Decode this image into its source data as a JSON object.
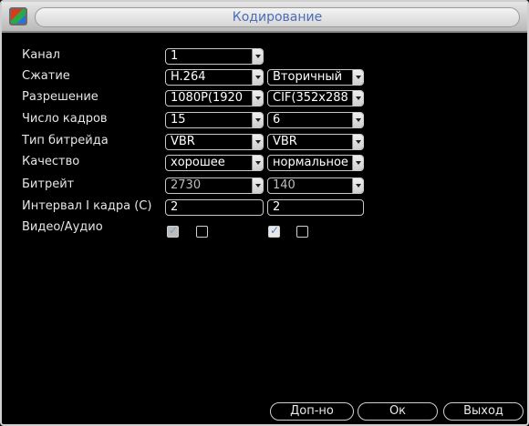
{
  "window": {
    "title": "Кодирование",
    "icon": "dvr-logo-icon"
  },
  "rows": [
    {
      "label": "Канал",
      "main": {
        "value": "1",
        "type": "select"
      }
    },
    {
      "label": "Сжатие",
      "main": {
        "value": "H.264",
        "type": "select"
      },
      "extra": {
        "value": "Вторичный",
        "type": "select"
      }
    },
    {
      "label": "Разрешение",
      "main": {
        "value": "1080P(1920",
        "type": "select"
      },
      "extra": {
        "value": "CIF(352x288",
        "type": "select"
      }
    },
    {
      "label": "Число кадров",
      "main": {
        "value": "15",
        "type": "select"
      },
      "extra": {
        "value": "6",
        "type": "select"
      }
    },
    {
      "label": "Тип битрейда",
      "main": {
        "value": "VBR",
        "type": "select"
      },
      "extra": {
        "value": "VBR",
        "type": "select"
      }
    },
    {
      "label": "Качество",
      "main": {
        "value": "хорошее",
        "type": "select"
      },
      "extra": {
        "value": "нормальное",
        "type": "select"
      }
    },
    {
      "label": "Битрейт",
      "main": {
        "value": "2730",
        "type": "select_disabled"
      },
      "extra": {
        "value": "140",
        "type": "select_disabled"
      }
    },
    {
      "label": "Интервал I кадра (С)",
      "main": {
        "value": "2",
        "type": "text"
      },
      "extra": {
        "value": "2",
        "type": "text"
      }
    },
    {
      "label": "Видео/Аудио",
      "main": {
        "video": true,
        "audio": false,
        "video_dim": true
      },
      "extra": {
        "video": true,
        "audio": false
      }
    }
  ],
  "buttons": {
    "advanced": "Доп-но",
    "ok": "Ок",
    "exit": "Выход"
  }
}
